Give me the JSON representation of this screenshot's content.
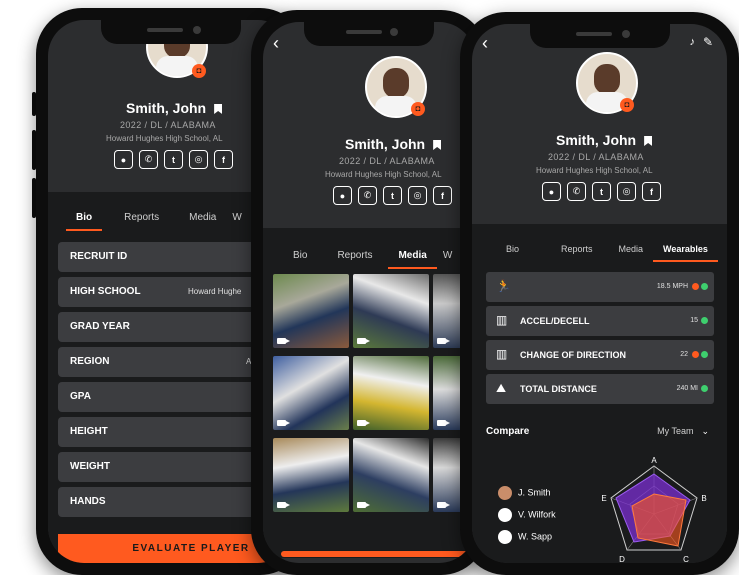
{
  "colors": {
    "accent": "#ff5a1f",
    "row_bg": "#3c3d40",
    "screen_bg": "#2c2d2f",
    "ok": "#3ecf6e"
  },
  "player": {
    "name": "Smith, John",
    "meta": "2022  /  DL  /  ALABAMA",
    "school": "Howard Hughes High School, AL"
  },
  "social_icons": [
    "message-icon",
    "phone-icon",
    "twitter-icon",
    "instagram-icon",
    "facebook-icon"
  ],
  "phone1": {
    "tabs": [
      "Bio",
      "Reports",
      "Media",
      "W"
    ],
    "rows": [
      {
        "label": "RECRUIT ID",
        "value": ""
      },
      {
        "label": "HIGH SCHOOL",
        "value": "Howard Hughe"
      },
      {
        "label": "GRAD YEAR",
        "value": ""
      },
      {
        "label": "REGION",
        "value": "A"
      },
      {
        "label": "GPA",
        "value": ""
      },
      {
        "label": "HEIGHT",
        "value": ""
      },
      {
        "label": "WEIGHT",
        "value": ""
      },
      {
        "label": "HANDS",
        "value": ""
      }
    ],
    "evaluate_label": "EVALUATE PLAYER"
  },
  "phone2": {
    "back": "‹",
    "tabs": [
      "Bio",
      "Reports",
      "Media",
      "W"
    ]
  },
  "phone3": {
    "back": "‹",
    "tabs": [
      "Bio",
      "Reports",
      "Media",
      "Wearables"
    ],
    "metrics": [
      {
        "icon": "sprint-icon",
        "label": "",
        "value": "18.5 MPH"
      },
      {
        "icon": "accel-icon",
        "label": "ACCEL/DECELL",
        "value": "15"
      },
      {
        "icon": "direction-icon",
        "label": "CHANGE OF DIRECTION",
        "value": "22"
      },
      {
        "icon": "distance-icon",
        "label": "TOTAL DISTANCE",
        "value": "240 MI"
      }
    ],
    "compare_label": "Compare",
    "team_select": "My Team",
    "legend": [
      "J. Smith",
      "V. Wilfork",
      "W. Sapp"
    ],
    "radar_axes": [
      "A",
      "B",
      "C",
      "D",
      "E"
    ]
  }
}
